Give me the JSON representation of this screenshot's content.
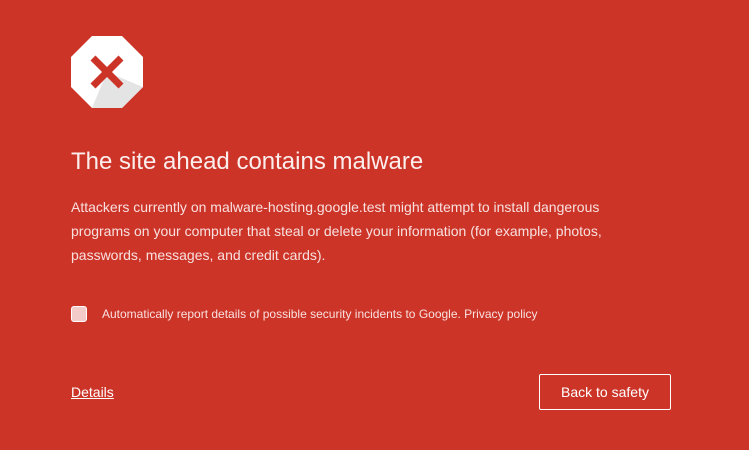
{
  "interstitial": {
    "icon": "malware-warning-icon",
    "heading": "The site ahead contains malware",
    "description": "Attackers currently on malware-hosting.google.test might attempt to install dangerous programs on your computer that steal or delete your information (for example, photos, passwords, messages, and credit cards).",
    "report_label": "Automatically report details of possible security incidents to Google. Privacy policy",
    "report_checked": false,
    "details_link": "Details",
    "back_button": "Back to safety"
  },
  "colors": {
    "background": "#cd3428",
    "text": "#ffffff",
    "icon_cross": "#cd3428"
  }
}
